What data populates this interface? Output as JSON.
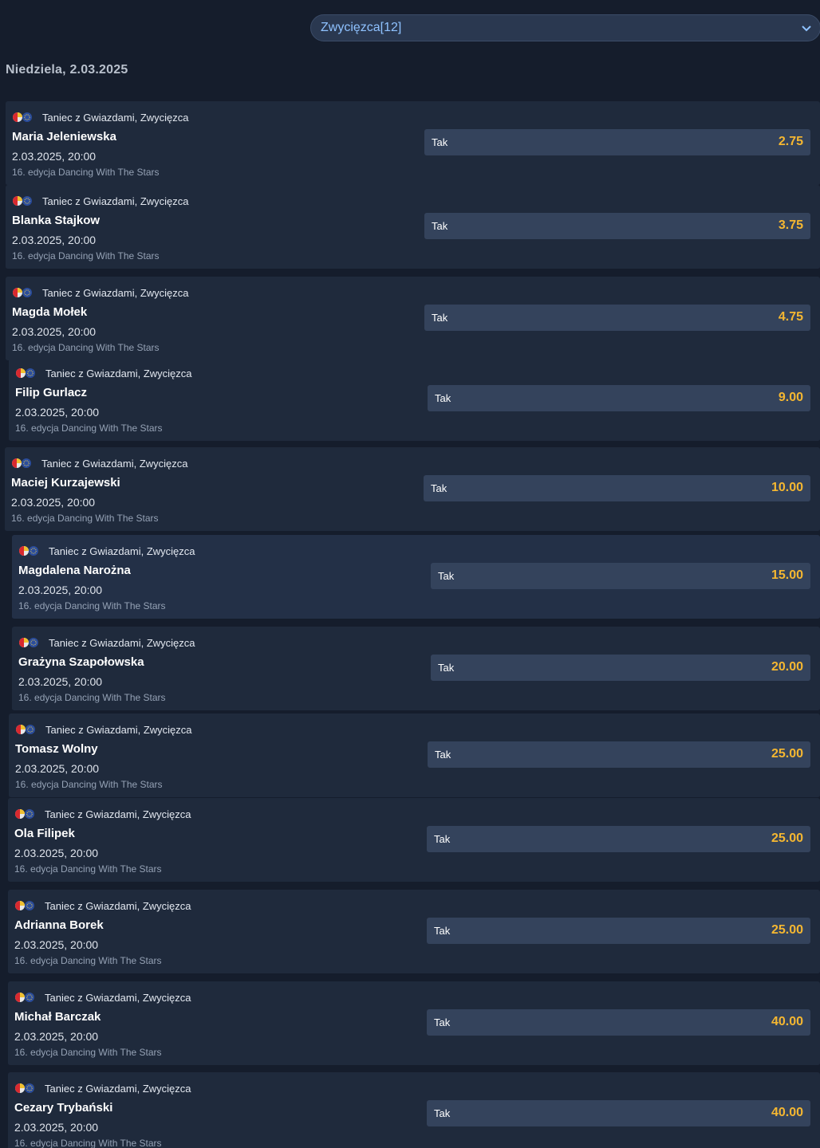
{
  "market_select": {
    "label": "Zwycięzca[12]"
  },
  "date_header": "Niedziela, 2.03.2025",
  "events": [
    {
      "league": "Taniec z Gwiazdami, Zwycięzca",
      "participant": "Maria Jeleniewska",
      "datetime": "2.03.2025, 20:00",
      "description": "16. edycja Dancing With The Stars",
      "outcome": "Tak",
      "odds": "2.75"
    },
    {
      "league": "Taniec z Gwiazdami, Zwycięzca",
      "participant": "Blanka Stajkow",
      "datetime": "2.03.2025, 20:00",
      "description": "16. edycja Dancing With The Stars",
      "outcome": "Tak",
      "odds": "3.75"
    },
    {
      "league": "Taniec z Gwiazdami, Zwycięzca",
      "participant": "Magda Mołek",
      "datetime": "2.03.2025, 20:00",
      "description": "16. edycja Dancing With The Stars",
      "outcome": "Tak",
      "odds": "4.75"
    },
    {
      "league": "Taniec z Gwiazdami, Zwycięzca",
      "participant": "Filip Gurlacz",
      "datetime": "2.03.2025, 20:00",
      "description": "16. edycja Dancing With The Stars",
      "outcome": "Tak",
      "odds": "9.00"
    },
    {
      "league": "Taniec z Gwiazdami, Zwycięzca",
      "participant": "Maciej Kurzajewski",
      "datetime": "2.03.2025, 20:00",
      "description": "16. edycja Dancing With The Stars",
      "outcome": "Tak",
      "odds": "10.00"
    },
    {
      "league": "Taniec z Gwiazdami, Zwycięzca",
      "participant": "Magdalena Narożna",
      "datetime": "2.03.2025, 20:00",
      "description": "16. edycja Dancing With The Stars",
      "outcome": "Tak",
      "odds": "15.00"
    },
    {
      "league": "Taniec z Gwiazdami, Zwycięzca",
      "participant": "Grażyna Szapołowska",
      "datetime": "2.03.2025, 20:00",
      "description": "16. edycja Dancing With The Stars",
      "outcome": "Tak",
      "odds": "20.00"
    },
    {
      "league": "Taniec z Gwiazdami, Zwycięzca",
      "participant": "Tomasz Wolny",
      "datetime": "2.03.2025, 20:00",
      "description": "16. edycja Dancing With The Stars",
      "outcome": "Tak",
      "odds": "25.00"
    },
    {
      "league": "Taniec z Gwiazdami, Zwycięzca",
      "participant": "Ola Filipek",
      "datetime": "2.03.2025, 20:00",
      "description": "16. edycja Dancing With The Stars",
      "outcome": "Tak",
      "odds": "25.00"
    },
    {
      "league": "Taniec z Gwiazdami, Zwycięzca",
      "participant": "Adrianna Borek",
      "datetime": "2.03.2025, 20:00",
      "description": "16. edycja Dancing With The Stars",
      "outcome": "Tak",
      "odds": "25.00"
    },
    {
      "league": "Taniec z Gwiazdami, Zwycięzca",
      "participant": "Michał Barczak",
      "datetime": "2.03.2025, 20:00",
      "description": "16. edycja Dancing With The Stars",
      "outcome": "Tak",
      "odds": "40.00"
    },
    {
      "league": "Taniec z Gwiazdami, Zwycięzca",
      "participant": "Cezary Trybański",
      "datetime": "2.03.2025, 20:00",
      "description": "16. edycja Dancing With The Stars",
      "outcome": "Tak",
      "odds": "40.00"
    }
  ],
  "colors": {
    "odds": "#f5b731",
    "select_text": "#8fc2ff",
    "card_bg": "#1f2a3c",
    "button_bg": "#34435c"
  }
}
